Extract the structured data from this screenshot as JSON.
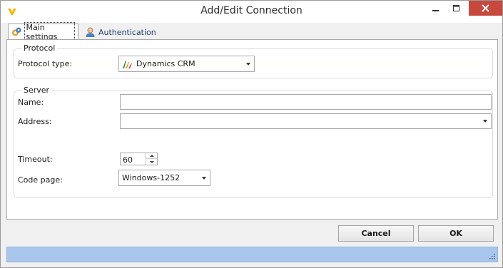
{
  "window": {
    "title": "Add/Edit Connection"
  },
  "titlebar_buttons": {
    "minimize_icon": "minimize-icon",
    "maximize_icon": "maximize-icon",
    "close_icon": "close-icon"
  },
  "tabs": [
    {
      "label": "Main settings",
      "icon": "gear-icon",
      "active": true
    },
    {
      "label": "Authentication",
      "icon": "user-icon",
      "active": false
    }
  ],
  "protocol": {
    "group_title": "Protocol",
    "type_label": "Protocol type:",
    "type_value": "Dynamics CRM",
    "type_icon": "dynamics-crm-icon"
  },
  "server": {
    "group_title": "Server",
    "name_label": "Name:",
    "name_value": "",
    "address_label": "Address:",
    "address_value": "",
    "timeout_label": "Timeout:",
    "timeout_value": "60",
    "codepage_label": "Code page:",
    "codepage_value": "Windows-1252"
  },
  "buttons": {
    "cancel": "Cancel",
    "ok": "OK"
  },
  "colors": {
    "close_button": "#c7483d",
    "status_bar": "#a9c6ec",
    "tab_text": "#1f3f7a"
  }
}
